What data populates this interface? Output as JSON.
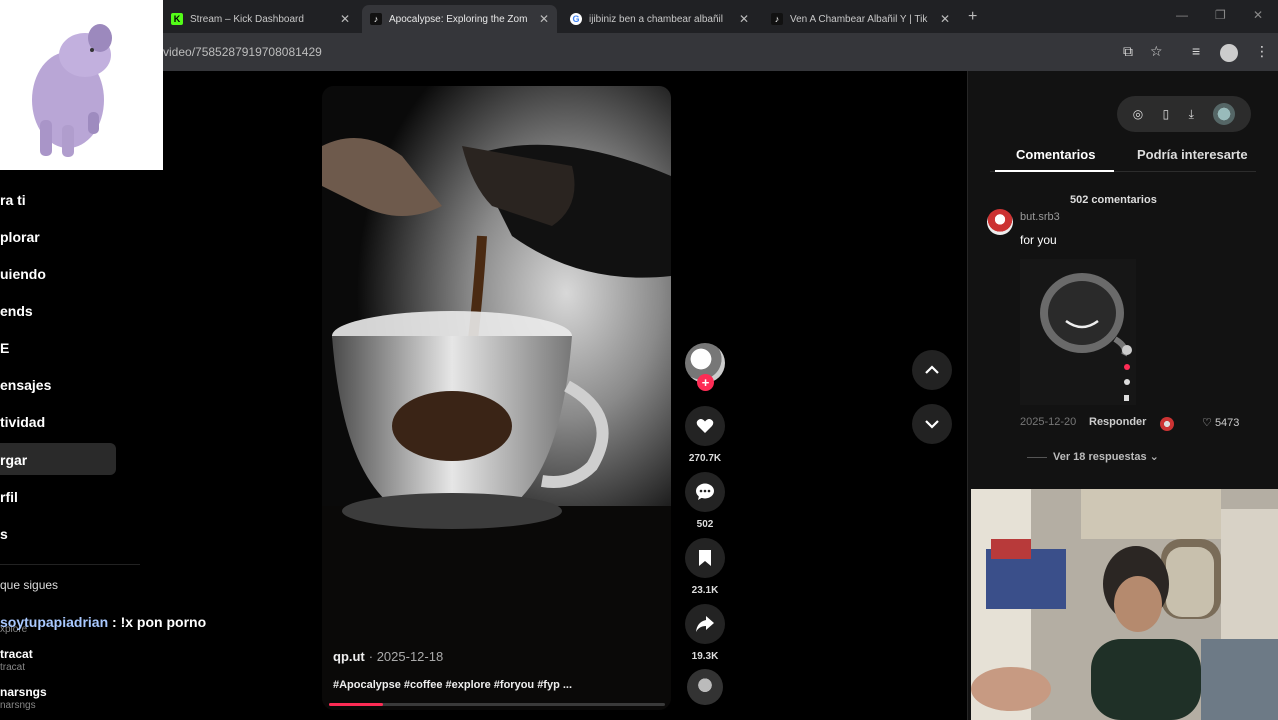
{
  "browser": {
    "tabs": [
      {
        "title": "Stream – Kick Dashboard",
        "favicon": "kick-icon"
      },
      {
        "title": "Apocalypse: Exploring the Zom",
        "favicon": "tiktok-icon"
      },
      {
        "title": "ijibiniz ben a chambear albañil",
        "favicon": "google-icon"
      },
      {
        "title": "Ven A Chambear Albañil Y | Tik",
        "favicon": "tiktok-icon"
      }
    ],
    "url": "video/7585287919708081429"
  },
  "sidebar": {
    "items": [
      "ra ti",
      "plorar",
      "uiendo",
      "ends",
      "E",
      "ensajes",
      "tividad",
      "rgar",
      "rfil",
      "s"
    ],
    "selected_index": 7,
    "following_header": "que sigues",
    "following": [
      {
        "name": "tracat",
        "handle": "tracat"
      },
      {
        "name": "narsngs",
        "handle": "narsngs"
      }
    ],
    "partial_handle": "xplore"
  },
  "chat_overlay": {
    "user": "soytupapiadrian",
    "message": " : !x pon porno"
  },
  "video": {
    "author": "qp.ut",
    "date": "· 2025-12-18",
    "tags": "#Apocalypse #coffee #explore #foryou #fyp ...",
    "progress_percent": 16
  },
  "actions": {
    "likes": "270.7K",
    "comments": "502",
    "saves": "23.1K",
    "shares": "19.3K",
    "follow_symbol": "+"
  },
  "panel": {
    "tabs": [
      "Comentarios",
      "Podría interesarte"
    ],
    "comment_count_label": "502 comentarios",
    "comment": {
      "user": "but.srb3",
      "text": "for you",
      "date": "2025-12-20",
      "reply_label": "Responder",
      "likes": "5473"
    },
    "view_replies": "Ver 18 respuestas"
  }
}
